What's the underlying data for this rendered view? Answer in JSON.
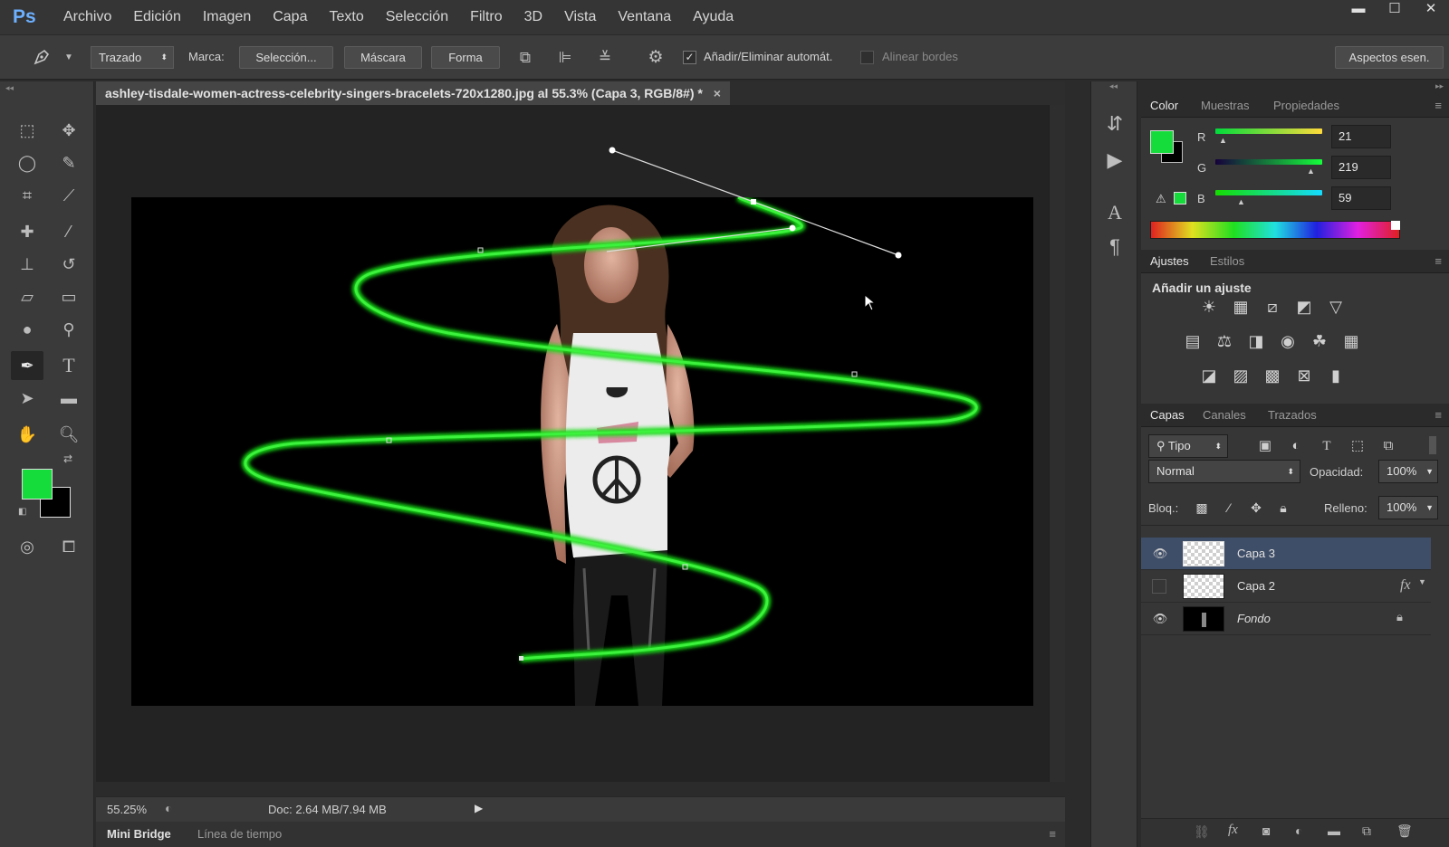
{
  "app": {
    "logo": "Ps"
  },
  "menubar": {
    "items": [
      "Archivo",
      "Edición",
      "Imagen",
      "Capa",
      "Texto",
      "Selección",
      "Filtro",
      "3D",
      "Vista",
      "Ventana",
      "Ayuda"
    ]
  },
  "window_controls": {
    "minimize": "▬",
    "maximize": "☐",
    "close": "✕"
  },
  "options_bar": {
    "tool_preset_icon": "pen-icon",
    "mode_select": "Trazado",
    "marca_label": "Marca:",
    "seleccion_button": "Selección...",
    "mascara_button": "Máscara",
    "forma_button": "Forma",
    "auto_add_delete_checked": true,
    "auto_add_delete_label": "Añadir/Eliminar automát.",
    "align_edges_checked": false,
    "align_edges_label": "Alinear bordes",
    "workspace_button": "Aspectos esen."
  },
  "toolbar": {
    "tools": [
      "marquee",
      "move",
      "lasso",
      "quick-select",
      "crop",
      "eyedropper",
      "healing",
      "brush",
      "stamp",
      "history-brush",
      "eraser",
      "gradient",
      "blur",
      "dodge",
      "pen",
      "type",
      "path-select",
      "rectangle",
      "hand",
      "zoom"
    ],
    "active_tool": "pen",
    "foreground_color": "#15db3b",
    "background_color": "#000000"
  },
  "document": {
    "tab_title": "ashley-tisdale-women-actress-celebrity-singers-bracelets-720x1280.jpg al 55.3% (Capa 3, RGB/8#) *",
    "tab_close": "×",
    "stroke_color": "#14dc14"
  },
  "status": {
    "zoom": "55.25%",
    "doc_info": "Doc: 2.64 MB/7.94 MB"
  },
  "bottom_tabs": [
    "Mini Bridge",
    "Línea de tiempo"
  ],
  "color_panel": {
    "tabs": [
      "Color",
      "Muestras",
      "Propiedades"
    ],
    "channels": [
      {
        "label": "R",
        "value": "21"
      },
      {
        "label": "G",
        "value": "219"
      },
      {
        "label": "B",
        "value": "59"
      }
    ],
    "swatch_color": "#15db3b"
  },
  "adjustments_panel": {
    "tabs": [
      "Ajustes",
      "Estilos"
    ],
    "heading": "Añadir un ajuste"
  },
  "layers_panel": {
    "tabs": [
      "Capas",
      "Canales",
      "Trazados"
    ],
    "filter_kind": "Tipo",
    "blend_mode": "Normal",
    "opacity_label": "Opacidad:",
    "opacity_value": "100%",
    "lock_label": "Bloq.:",
    "fill_label": "Relleno:",
    "fill_value": "100%",
    "layers": [
      {
        "name": "Capa 3",
        "visible": true,
        "selected": true
      },
      {
        "name": "Capa 2",
        "visible": false,
        "fx": "fx"
      },
      {
        "name": "Fondo",
        "visible": true,
        "locked": true
      }
    ]
  }
}
